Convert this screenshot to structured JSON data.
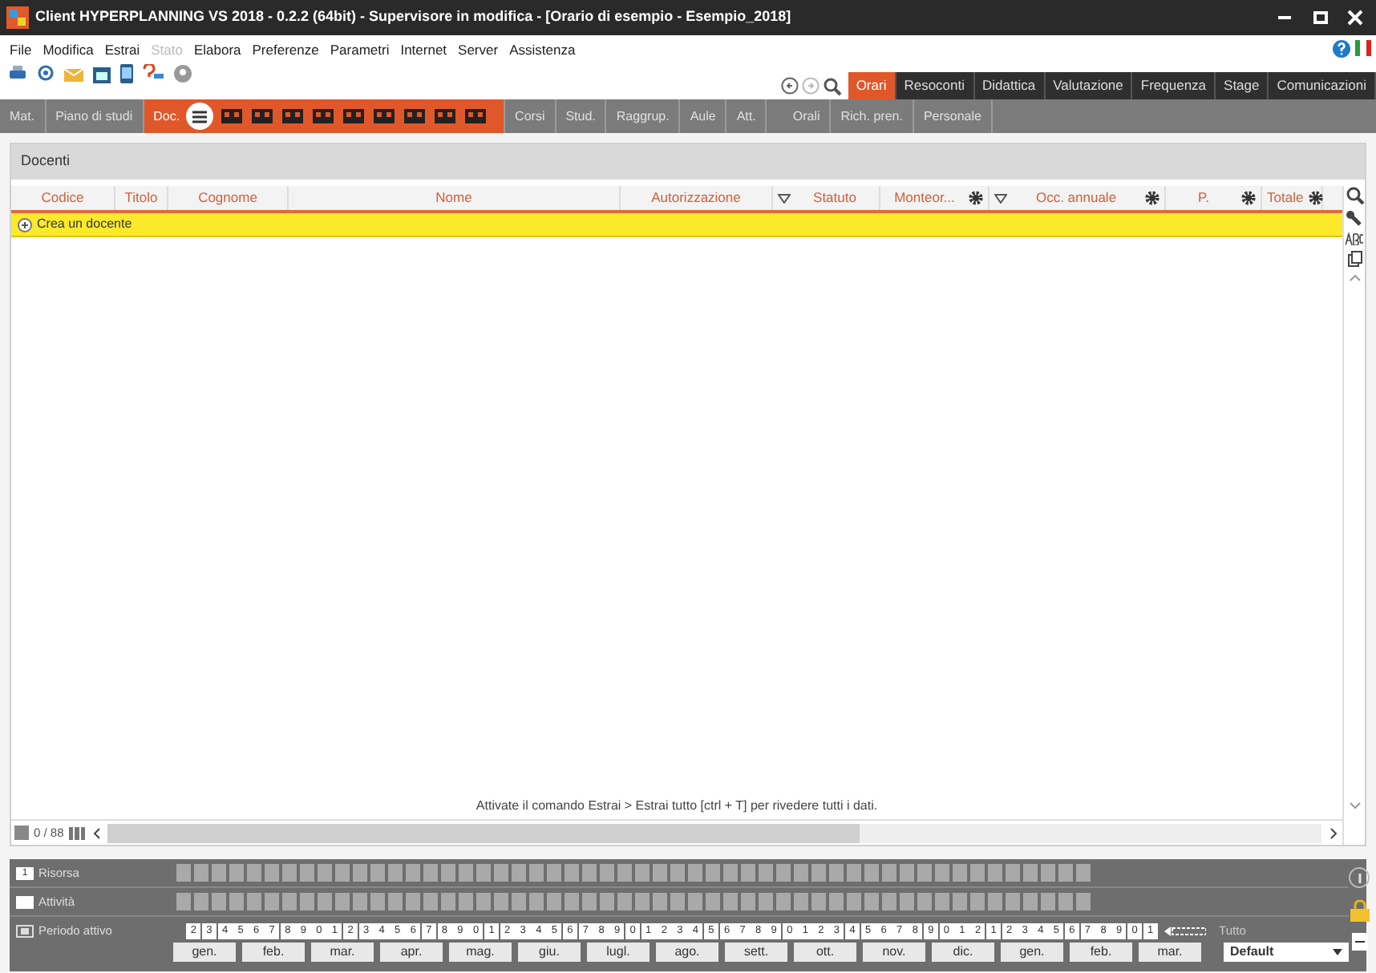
{
  "window": {
    "title": "Client HYPERPLANNING VS 2018 - 0.2.2 (64bit) - Supervisore in modifica - [Orario di esempio - Esempio_2018]"
  },
  "menu": [
    {
      "label": "File",
      "disabled": false
    },
    {
      "label": "Modifica",
      "disabled": false
    },
    {
      "label": "Estrai",
      "disabled": false
    },
    {
      "label": "Stato",
      "disabled": true
    },
    {
      "label": "Elabora",
      "disabled": false
    },
    {
      "label": "Preferenze",
      "disabled": false
    },
    {
      "label": "Parametri",
      "disabled": false
    },
    {
      "label": "Internet",
      "disabled": false
    },
    {
      "label": "Server",
      "disabled": false
    },
    {
      "label": "Assistenza",
      "disabled": false
    }
  ],
  "main_tabs": [
    {
      "label": "Orari",
      "selected": true
    },
    {
      "label": "Resoconti",
      "selected": false
    },
    {
      "label": "Didattica",
      "selected": false
    },
    {
      "label": "Valutazione",
      "selected": false
    },
    {
      "label": "Frequenza",
      "selected": false
    },
    {
      "label": "Stage",
      "selected": false
    },
    {
      "label": "Comunicazioni",
      "selected": false
    }
  ],
  "sub_tabs": [
    {
      "label": "Mat.",
      "selected": false
    },
    {
      "label": "Piano di studi",
      "selected": false
    },
    {
      "label": "Doc.",
      "selected": true
    },
    {
      "label": "Corsi",
      "selected": false
    },
    {
      "label": "Stud.",
      "selected": false
    },
    {
      "label": "Raggrup.",
      "selected": false
    },
    {
      "label": "Aule",
      "selected": false
    },
    {
      "label": "Att.",
      "selected": false
    },
    {
      "label": "Orali",
      "selected": false
    },
    {
      "label": "Rich. pren.",
      "selected": false
    },
    {
      "label": "Personale",
      "selected": false
    }
  ],
  "panel_title": "Docenti",
  "columns": [
    {
      "label": "Codice",
      "filter": false,
      "gear": false
    },
    {
      "label": "Titolo",
      "filter": false,
      "gear": false
    },
    {
      "label": "Cognome",
      "filter": false,
      "gear": false
    },
    {
      "label": "Nome",
      "filter": false,
      "gear": false
    },
    {
      "label": "Autorizzazione",
      "filter": false,
      "gear": false
    },
    {
      "label": "Statuto",
      "filter": true,
      "gear": false
    },
    {
      "label": "Monteor...",
      "filter": false,
      "gear": true
    },
    {
      "label": "Occ. annuale",
      "filter": true,
      "gear": true
    },
    {
      "label": "P.",
      "filter": false,
      "gear": true
    },
    {
      "label": "Totale",
      "filter": false,
      "gear": true
    }
  ],
  "create_row": "Crea un docente",
  "message": "Attivate il comando Estrai > Estrai tutto [ctrl + T] per rivedere tutti i dati.",
  "counter": "0 / 88",
  "timeline": {
    "rows": [
      {
        "label": "Risorsa",
        "badge": "1"
      },
      {
        "label": "Attività",
        "badge": ""
      }
    ],
    "period_label": "Periodo attivo",
    "weeks": [
      "2",
      "3",
      "4",
      "5",
      "6",
      "7",
      "8",
      "9",
      "0",
      "1",
      "2",
      "3",
      "4",
      "5",
      "6",
      "7",
      "8",
      "9",
      "0",
      "1",
      "2",
      "3",
      "4",
      "5",
      "6",
      "7",
      "8",
      "9",
      "0",
      "1",
      "2",
      "3",
      "4",
      "5",
      "6",
      "7",
      "8",
      "9",
      "0",
      "1",
      "2",
      "3",
      "4",
      "5",
      "6",
      "7",
      "8",
      "9",
      "0",
      "1",
      "2",
      "1",
      "2",
      "3",
      "4",
      "5",
      "6",
      "7",
      "8",
      "9",
      "0",
      "1"
    ],
    "months": [
      "gen.",
      "feb.",
      "mar.",
      "apr.",
      "mag.",
      "giu.",
      "lugl.",
      "ago.",
      "sett.",
      "ott.",
      "nov.",
      "dic.",
      "gen.",
      "feb.",
      "mar."
    ],
    "all_label": "Tutto",
    "preset": "Default"
  }
}
